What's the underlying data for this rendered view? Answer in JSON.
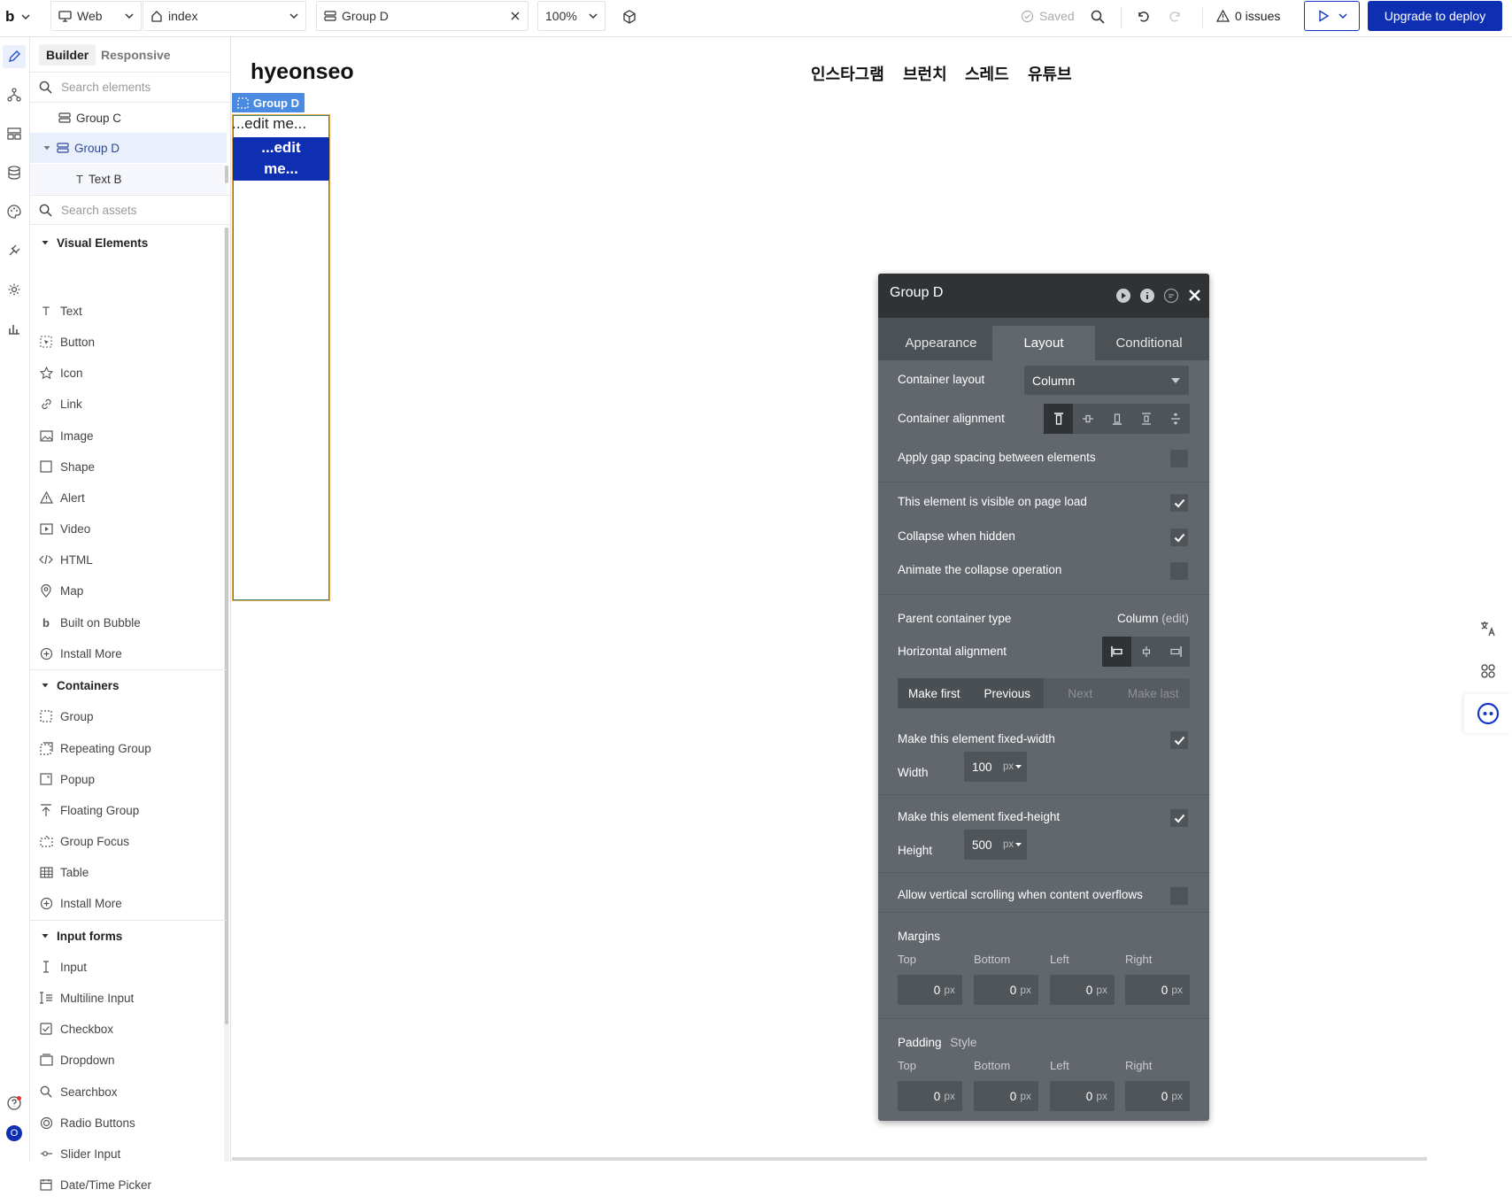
{
  "topbar": {
    "logo": "b",
    "platform": "Web",
    "page": "index",
    "element": "Group D",
    "zoom": "100%",
    "saved": "Saved",
    "issues": "0 issues",
    "deploy": "Upgrade to deploy"
  },
  "leftpanel": {
    "tab_builder": "Builder",
    "tab_responsive": "Responsive",
    "search_elements_placeholder": "Search elements",
    "search_assets_placeholder": "Search assets",
    "tree": [
      "Group C",
      "Group D",
      "Text B"
    ],
    "categories": {
      "visual": "Visual Elements",
      "containers": "Containers",
      "inputs": "Input forms"
    },
    "visual_items": [
      "Text",
      "Button",
      "Icon",
      "Link",
      "Image",
      "Shape",
      "Alert",
      "Video",
      "HTML",
      "Map",
      "Built on Bubble",
      "Install More"
    ],
    "container_items": [
      "Group",
      "Repeating Group",
      "Popup",
      "Floating Group",
      "Group Focus",
      "Table",
      "Install More"
    ],
    "input_items": [
      "Input",
      "Multiline Input",
      "Checkbox",
      "Dropdown",
      "Searchbox",
      "Radio Buttons",
      "Slider Input",
      "Date/Time Picker"
    ]
  },
  "canvas": {
    "brand": "hyeonseo",
    "nav": [
      "인스타그램",
      "브런치",
      "스레드",
      "유튜브"
    ],
    "selection_tag": "Group D",
    "text_placeholder": "...edit me...",
    "button_line1": "...edit",
    "button_line2": "me..."
  },
  "props": {
    "title": "Group D",
    "tabs": [
      "Appearance",
      "Layout",
      "Conditional"
    ],
    "container_layout_label": "Container layout",
    "container_layout_value": "Column",
    "container_alignment_label": "Container alignment",
    "gap_label": "Apply gap spacing between elements",
    "visible_label": "This element is visible on page load",
    "collapse_label": "Collapse when hidden",
    "animate_label": "Animate the collapse operation",
    "parent_type_label": "Parent container type",
    "parent_type_value": "Column",
    "parent_type_edit": "(edit)",
    "h_align_label": "Horizontal alignment",
    "order": [
      "Make first",
      "Previous",
      "Next",
      "Make last"
    ],
    "fixed_width_label": "Make this element fixed-width",
    "width_label": "Width",
    "width_value": "100",
    "height_label": "Height",
    "height_value": "500",
    "unit": "px",
    "fixed_height_label": "Make this element fixed-height",
    "scroll_label": "Allow vertical scrolling when content overflows",
    "margins_label": "Margins",
    "padding_label": "Padding",
    "padding_style": "Style",
    "side_labels": [
      "Top",
      "Bottom",
      "Left",
      "Right"
    ],
    "margin_values": [
      "0",
      "0",
      "0",
      "0"
    ],
    "padding_values": [
      "0",
      "0",
      "0",
      "0"
    ]
  }
}
